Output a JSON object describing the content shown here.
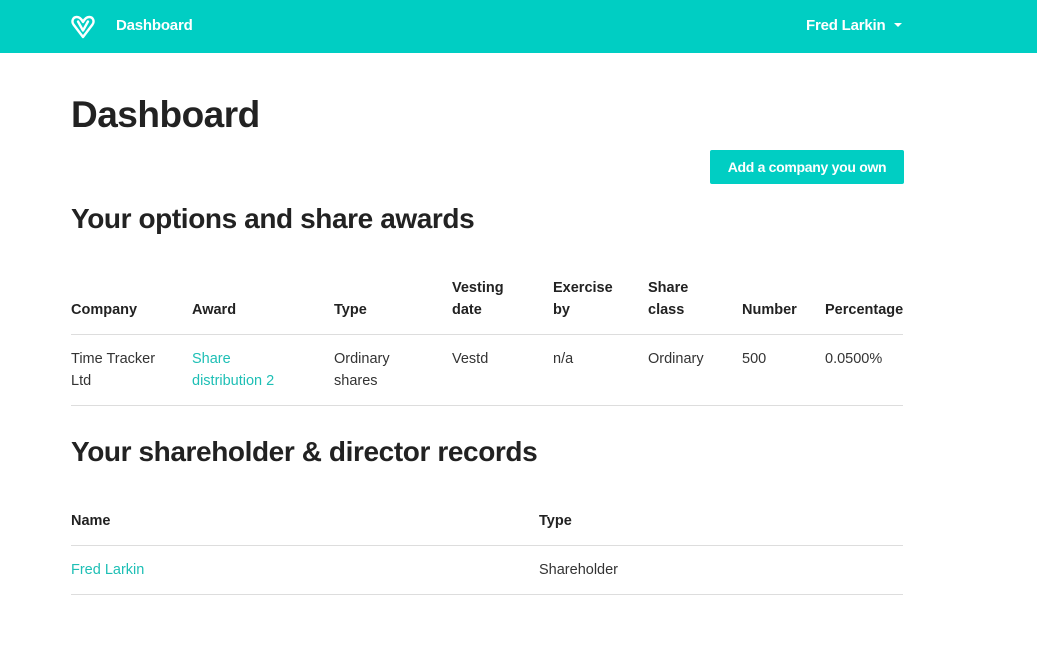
{
  "navbar": {
    "brand_label": "Dashboard",
    "logo_icon": "heart-v-logo-icon",
    "user_name": "Fred Larkin",
    "background_color": "#00cec3"
  },
  "page": {
    "title": "Dashboard",
    "add_company_label": "Add a company you own"
  },
  "options_section": {
    "title": "Your options and share awards",
    "headers": {
      "company": "Company",
      "award": "Award",
      "type": "Type",
      "vesting_date": "Vesting date",
      "exercise_by": "Exercise by",
      "share_class": "Share class",
      "number": "Number",
      "percentage": "Percentage"
    },
    "rows": [
      {
        "company": "Time Tracker Ltd",
        "award": "Share distribution 2",
        "type": "Ordinary shares",
        "vesting_date": "Vestd",
        "exercise_by": "n/a",
        "share_class": "Ordinary",
        "number": "500",
        "percentage": "0.0500%"
      }
    ]
  },
  "records_section": {
    "title": "Your shareholder & director records",
    "headers": {
      "name": "Name",
      "type": "Type"
    },
    "rows": [
      {
        "name": "Fred Larkin",
        "type": "Shareholder"
      }
    ]
  },
  "colors": {
    "accent": "#00cec3",
    "link": "#1ebfb5",
    "text": "#222222",
    "divider": "#dddddd"
  }
}
